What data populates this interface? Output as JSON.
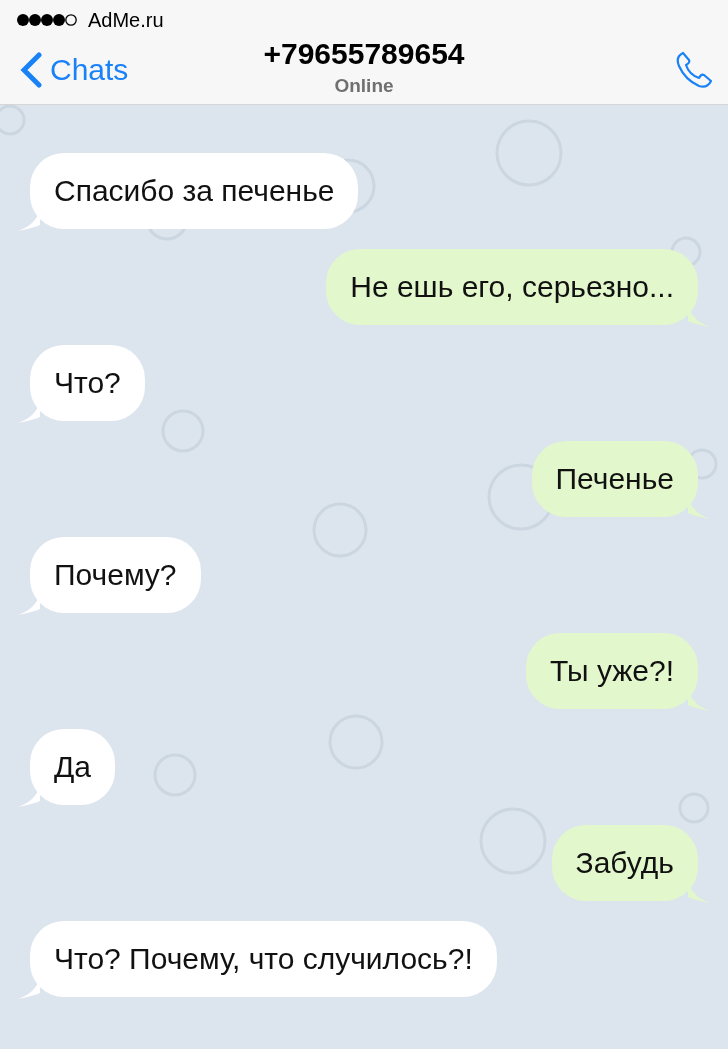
{
  "status_bar": {
    "carrier": "AdMe.ru"
  },
  "header": {
    "back": "Chats",
    "title": "+79655789654",
    "subtitle": "Online"
  },
  "messages": [
    {
      "kind": "incoming",
      "text": "Спасибо за печенье"
    },
    {
      "kind": "outgoing",
      "text": "Не ешь его, серьезно..."
    },
    {
      "kind": "incoming",
      "text": "Что?"
    },
    {
      "kind": "outgoing",
      "text": "Печенье"
    },
    {
      "kind": "incoming",
      "text": "Почему?"
    },
    {
      "kind": "outgoing",
      "text": "Ты уже?!"
    },
    {
      "kind": "incoming",
      "text": "Да"
    },
    {
      "kind": "outgoing",
      "text": "Забудь"
    },
    {
      "kind": "incoming",
      "text": "Что? Почему, что случилось?!"
    }
  ]
}
